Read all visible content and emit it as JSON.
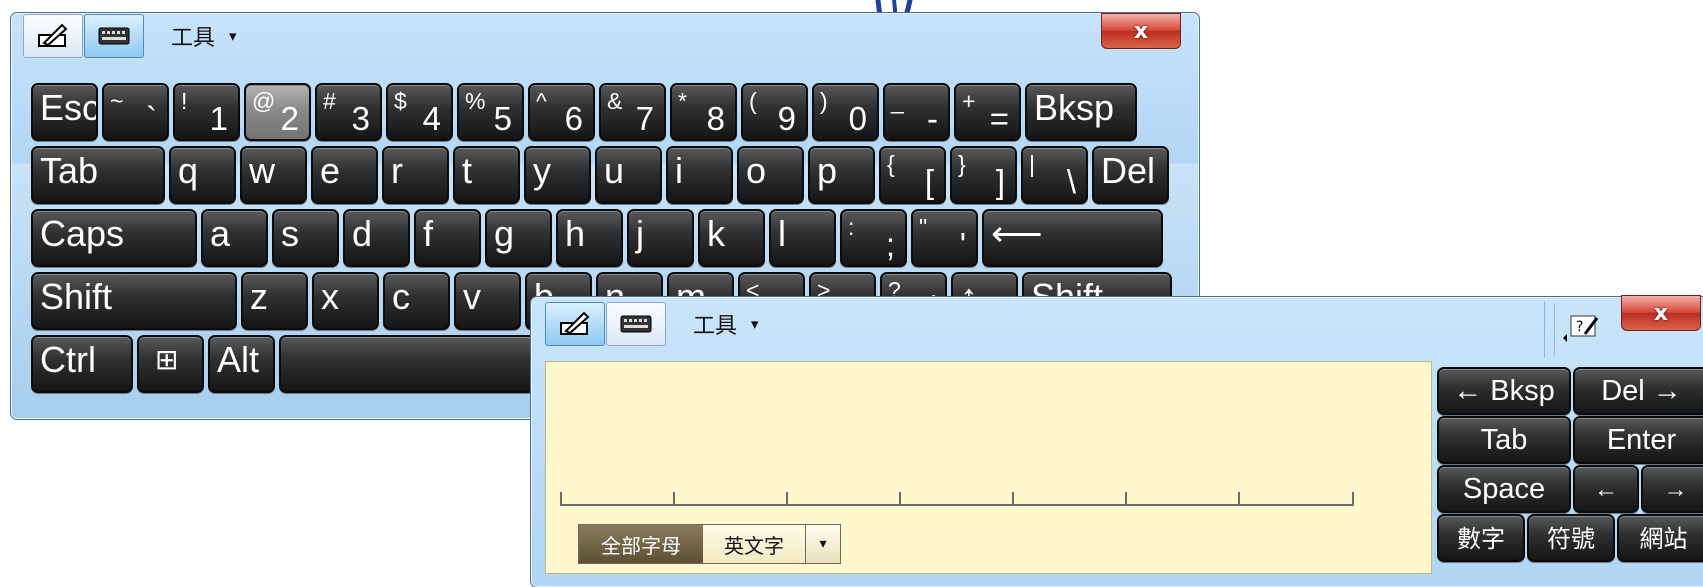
{
  "keyboard": {
    "toolbar": {
      "pen_icon": "pen-icon",
      "keyboard_icon": "keyboard-icon",
      "tools_label": "工具",
      "tools_caret": "▾",
      "close_label": "x"
    },
    "rows": [
      [
        {
          "label": "Esc"
        },
        {
          "shift": "~",
          "base": "`"
        },
        {
          "shift": "!",
          "base": "1"
        },
        {
          "shift": "@",
          "base": "2",
          "pressed": true
        },
        {
          "shift": "#",
          "base": "3"
        },
        {
          "shift": "$",
          "base": "4"
        },
        {
          "shift": "%",
          "base": "5"
        },
        {
          "shift": "^",
          "base": "6"
        },
        {
          "shift": "&",
          "base": "7"
        },
        {
          "shift": "*",
          "base": "8"
        },
        {
          "shift": "(",
          "base": "9"
        },
        {
          "shift": ")",
          "base": "0"
        },
        {
          "shift": "_",
          "base": "-"
        },
        {
          "shift": "+",
          "base": "="
        },
        {
          "label": "Bksp"
        }
      ],
      [
        {
          "label": "Tab"
        },
        {
          "label": "q"
        },
        {
          "label": "w"
        },
        {
          "label": "e"
        },
        {
          "label": "r"
        },
        {
          "label": "t"
        },
        {
          "label": "y"
        },
        {
          "label": "u"
        },
        {
          "label": "i"
        },
        {
          "label": "o"
        },
        {
          "label": "p"
        },
        {
          "shift": "{",
          "base": "["
        },
        {
          "shift": "}",
          "base": "]"
        },
        {
          "shift": "|",
          "base": "\\"
        },
        {
          "label": "Del"
        }
      ],
      [
        {
          "label": "Caps"
        },
        {
          "label": "a"
        },
        {
          "label": "s"
        },
        {
          "label": "d"
        },
        {
          "label": "f"
        },
        {
          "label": "g"
        },
        {
          "label": "h"
        },
        {
          "label": "j"
        },
        {
          "label": "k"
        },
        {
          "label": "l"
        },
        {
          "shift": ":",
          "base": ";"
        },
        {
          "shift": "\"",
          "base": "'"
        },
        {
          "label": "⟵",
          "name": "enter-key"
        }
      ],
      [
        {
          "label": "Shift"
        },
        {
          "label": "z"
        },
        {
          "label": "x"
        },
        {
          "label": "c"
        },
        {
          "label": "v"
        },
        {
          "label": "b"
        },
        {
          "label": "n"
        },
        {
          "label": "m"
        },
        {
          "shift": "<",
          "base": ","
        },
        {
          "shift": ">",
          "base": "."
        },
        {
          "shift": "?",
          "base": "/"
        },
        {
          "label": "↑"
        },
        {
          "label": "Shift"
        }
      ],
      [
        {
          "label": "Ctrl"
        },
        {
          "label": "⊞",
          "name": "windows-key"
        },
        {
          "label": "Alt"
        },
        {
          "label": "",
          "name": "space-key"
        }
      ]
    ]
  },
  "pad": {
    "toolbar": {
      "pen_icon": "pen-icon",
      "keyboard_icon": "keyboard-icon",
      "tools_label": "工具",
      "tools_caret": "▾",
      "help_icon": "help-icon",
      "close_label": "x"
    },
    "modes": {
      "all_letters": "全部字母",
      "english_words": "英文字",
      "dropdown": "▾"
    },
    "keys": {
      "bksp": "← Bksp",
      "del": "Del →",
      "tab": "Tab",
      "enter": "Enter",
      "space": "Space",
      "left": "←",
      "right": "→",
      "numbers": "數字",
      "symbols": "符號",
      "web": "網站"
    }
  },
  "colors": {
    "window_bg": "#b9dbf7",
    "key_bg": "#202122",
    "pad_bg": "#fff8cf",
    "close_red": "#d5483a",
    "ink": "#1f3f9e"
  }
}
